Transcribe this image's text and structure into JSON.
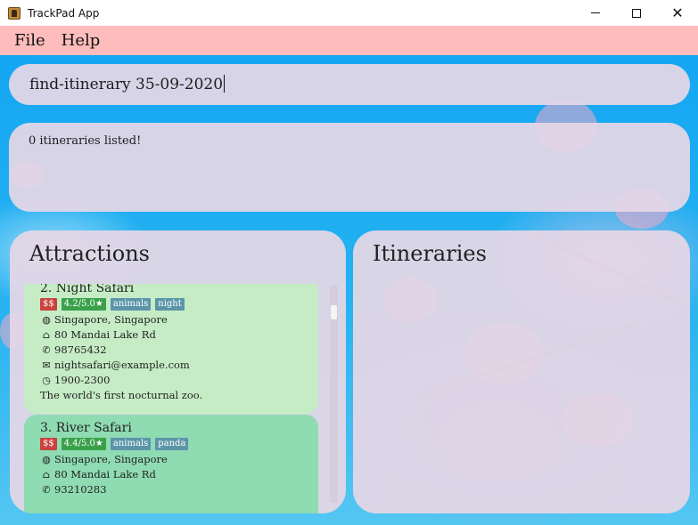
{
  "window": {
    "title": "TrackPad App"
  },
  "menu": {
    "items": [
      {
        "label": "File"
      },
      {
        "label": "Help"
      }
    ]
  },
  "command": {
    "value": "find-itinerary 35-09-2020"
  },
  "result": {
    "message": "0 itineraries listed!"
  },
  "attractions": {
    "title": "Attractions",
    "items": [
      {
        "name": "2.  Night Safari",
        "price": "$$",
        "rating": "4.2/5.0★",
        "tags": [
          "animals",
          "night"
        ],
        "location": "Singapore, Singapore",
        "address": "80 Mandai Lake Rd",
        "phone": "98765432",
        "email": "nightsafari@example.com",
        "hours": "1900-2300",
        "description": "The world's first nocturnal zoo."
      },
      {
        "name": "3.  River Safari",
        "price": "$$",
        "rating": "4.4/5.0★",
        "tags": [
          "animals",
          "panda"
        ],
        "location": "Singapore, Singapore",
        "address": "80 Mandai Lake Rd",
        "phone": "93210283"
      }
    ]
  },
  "itineraries": {
    "title": "Itineraries"
  },
  "icons": {
    "app": "app-icon",
    "location": "globe-icon",
    "address": "home-icon",
    "phone": "phone-icon",
    "email": "envelope-icon",
    "hours": "clock-icon"
  },
  "colors": {
    "menubar": "#ffbcbc",
    "panel": "#e6d7e6",
    "card_selected": "#c6ecc6",
    "card": "#8fdbb2",
    "tag_price": "#c9423e",
    "tag_rating": "#3aa14a",
    "tag_plain": "#5b95a8"
  }
}
